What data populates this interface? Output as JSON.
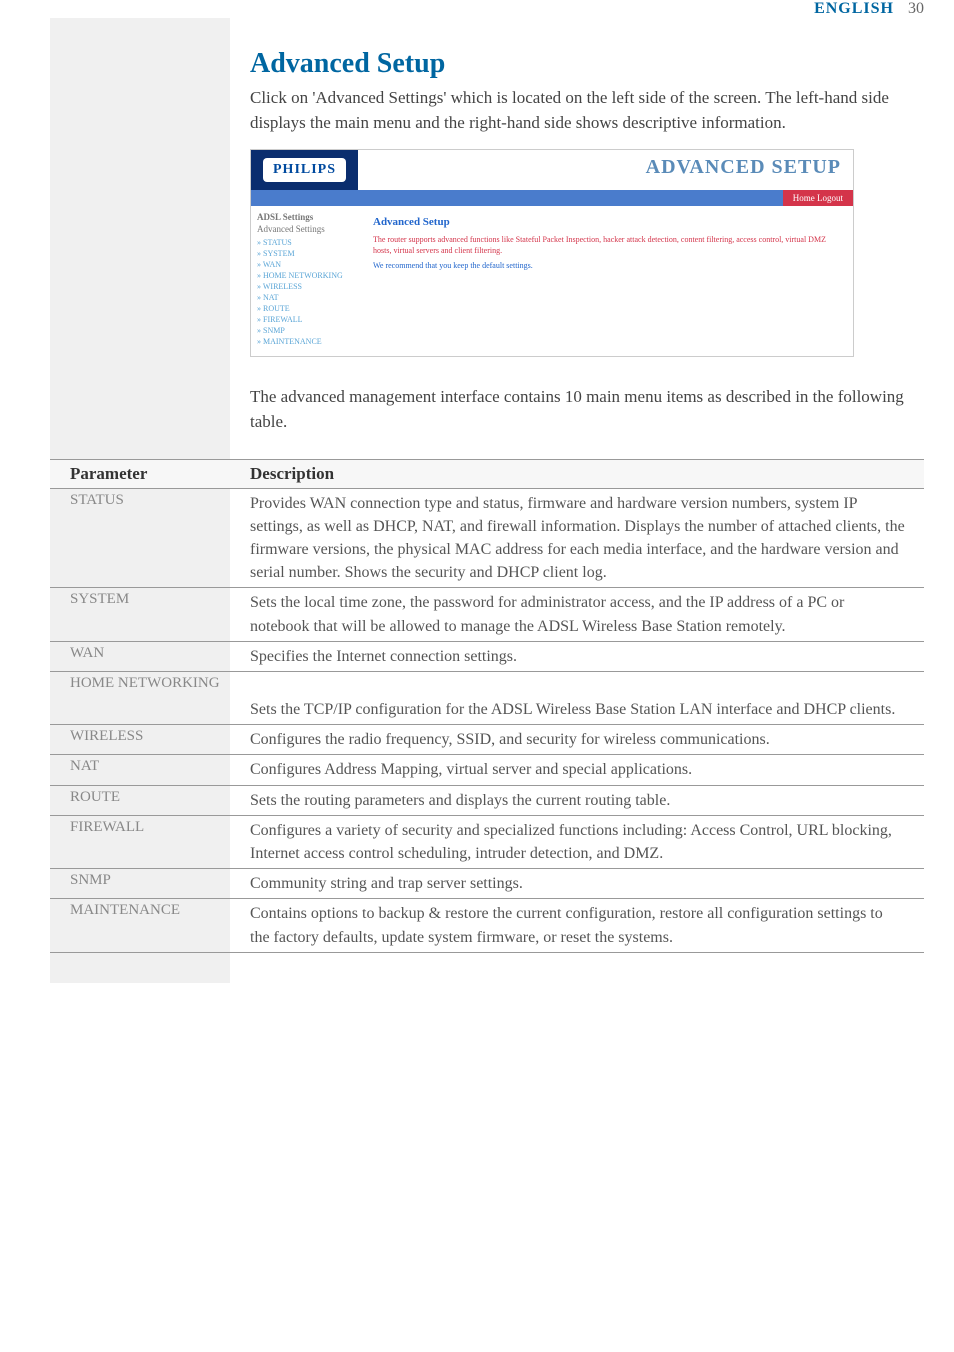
{
  "header": {
    "language": "ENGLISH",
    "page_number": "30"
  },
  "title": "Advanced Setup",
  "intro": "Click on 'Advanced Settings' which is located on the left side of the screen. The left-hand side displays the main menu and the right-hand side shows descriptive information.",
  "screenshot": {
    "logo": "PHILIPS",
    "banner_title": "ADVANCED SETUP",
    "tag": "Home  Logout",
    "nav_heading1": "ADSL Settings",
    "nav_heading2": "Advanced Settings",
    "nav_items": [
      "» STATUS",
      "» SYSTEM",
      "» WAN",
      "» HOME NETWORKING",
      "» WIRELESS",
      "» NAT",
      "» ROUTE",
      "» FIREWALL",
      "» SNMP",
      "» MAINTENANCE"
    ],
    "main_heading": "Advanced Setup",
    "main_p1": "The router supports advanced functions like Stateful Packet Inspection, hacker attack detection, content filtering, access control, virtual DMZ hosts, virtual servers and client filtering.",
    "main_p2": "We recommend that you keep the default settings."
  },
  "mid_text": "The advanced management interface contains 10 main menu items as described in the following table.",
  "table": {
    "header_param": "Parameter",
    "header_desc": "Description",
    "rows": [
      {
        "param": "STATUS",
        "desc": "Provides WAN connection type and status, firmware and hardware version numbers, system IP settings, as well as DHCP, NAT, and firewall information. Displays the number of attached clients, the firmware versions, the physical MAC address for each media interface, and the hardware version and serial number. Shows the security and DHCP client log."
      },
      {
        "param": "SYSTEM",
        "desc": "Sets the local time zone, the password for administrator access, and the IP address of a PC or notebook that will be allowed to manage the ADSL Wireless Base Station remotely."
      },
      {
        "param": "WAN",
        "desc": "Specifies the Internet connection settings."
      },
      {
        "param": "HOME NETWORKING",
        "desc": "Sets the TCP/IP configuration for the ADSL Wireless Base Station LAN interface and DHCP clients."
      },
      {
        "param": "WIRELESS",
        "desc": "Configures the radio frequency, SSID, and security for wireless communications."
      },
      {
        "param": "NAT",
        "desc": "Configures Address Mapping, virtual server and special applications."
      },
      {
        "param": "ROUTE",
        "desc": "Sets the routing parameters and displays the current routing table."
      },
      {
        "param": "FIREWALL",
        "desc": "Configures a variety of security and specialized functions including: Access Control, URL blocking, Internet access control scheduling, intruder detection, and DMZ."
      },
      {
        "param": "SNMP",
        "desc": "Community string and trap server settings."
      },
      {
        "param": "MAINTENANCE",
        "desc": "Contains options to backup & restore the current configuration, restore all configuration settings to the factory defaults, update system firmware, or reset the systems."
      }
    ]
  }
}
